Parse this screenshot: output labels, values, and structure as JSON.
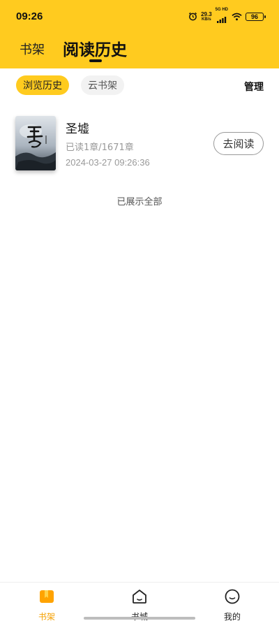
{
  "status_bar": {
    "time": "09:26",
    "net_speed_value": "29.3",
    "net_speed_unit": "KB/s",
    "signal_label": "5G HD",
    "battery": "96",
    "icons": [
      "alarm-icon",
      "signal-icon",
      "wifi-icon",
      "battery-icon"
    ]
  },
  "header": {
    "tab_shelf": "书架",
    "tab_history": "阅读历史"
  },
  "filters": {
    "browse_history": "浏览历史",
    "cloud_shelf": "云书架",
    "manage": "管理"
  },
  "books": [
    {
      "title": "圣墟",
      "progress": "已读1章/1671章",
      "last_read": "2024-03-27 09:26:36",
      "action": "去阅读"
    }
  ],
  "list_end_text": "已展示全部",
  "bottom_nav": {
    "items": [
      {
        "label": "书架",
        "icon": "bookshelf-icon",
        "active": true
      },
      {
        "label": "书城",
        "icon": "store-icon",
        "active": false
      },
      {
        "label": "我的",
        "icon": "profile-icon",
        "active": false
      }
    ]
  },
  "colors": {
    "accent": "#FFCB1F",
    "active_nav": "#F5A000"
  }
}
